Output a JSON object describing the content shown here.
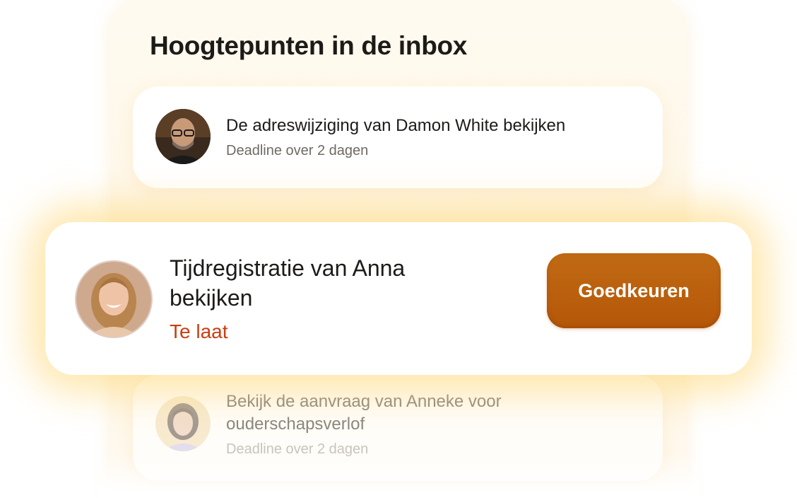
{
  "inbox": {
    "title": "Hoogtepunten in de inbox",
    "items": [
      {
        "title": "De adreswijziging van Damon White bekijken",
        "subtitle": "Deadline over 2 dagen",
        "avatar": "bald-man-with-glasses-avatar"
      },
      {
        "title": "Tijdregistratie van Anna bekijken",
        "status": "Te laat",
        "action_label": "Goedkeuren",
        "avatar": "smiling-woman-long-hair-avatar"
      },
      {
        "title": "Bekijk de aanvraag van Anneke voor ouderschapsverlof",
        "subtitle": "Deadline over 2 dagen",
        "avatar": "woman-short-hair-avatar"
      }
    ]
  },
  "colors": {
    "accent": "#b85c0c",
    "late": "#c93d12",
    "glow": "#ffd66e"
  }
}
